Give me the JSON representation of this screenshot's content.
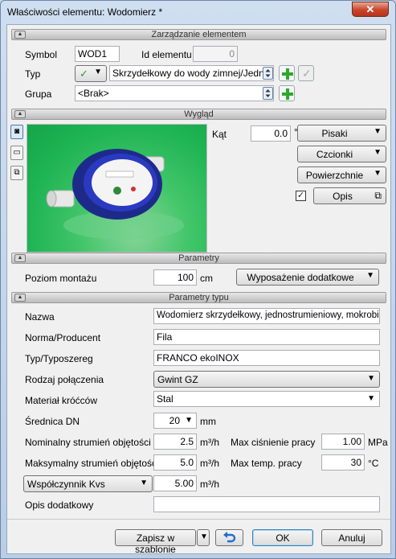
{
  "window": {
    "title": "Właściwości elementu: Wodomierz *",
    "close_glyph": "✕"
  },
  "sections": {
    "management": "Zarządzanie elementem",
    "appearance": "Wygląd",
    "params": "Parametry",
    "type_params": "Parametry typu"
  },
  "management": {
    "symbol_label": "Symbol",
    "symbol_value": "WOD1",
    "id_label": "Id elementu",
    "id_value": "0",
    "typ_label": "Typ",
    "typ_value": "Skrzydełkowy do wody zimnej/Jednost",
    "grupa_label": "Grupa",
    "grupa_value": "<Brak>"
  },
  "appearance": {
    "angle_label": "Kąt",
    "angle_value": "0.0",
    "angle_unit": "°",
    "pens_label": "Pisaki",
    "fonts_label": "Czcionki",
    "surfaces_label": "Powierzchnie",
    "description_label": "Opis",
    "description_checked": true
  },
  "parameters": {
    "mount_label": "Poziom montażu",
    "mount_value": "100",
    "mount_unit": "cm",
    "equipment_label": "Wyposażenie dodatkowe"
  },
  "type_params": {
    "name_label": "Nazwa",
    "name_value": "Wodomierz skrzydełkowy, jednostrumieniowy, mokrobieżny",
    "norm_label": "Norma/Producent",
    "norm_value": "Fila",
    "type_label": "Typ/Typoszereg",
    "type_value": "FRANCO ekoINOX",
    "conn_label": "Rodzaj połączenia",
    "conn_value": "Gwint GZ",
    "material_label": "Materiał króćców",
    "material_value": "Stal",
    "dn_label": "Średnica DN",
    "dn_value": "20",
    "dn_unit": "mm",
    "nominal_label": "Nominalny strumień objętości",
    "nominal_value": "2.5",
    "nominal_unit": "m³/h",
    "maxflow_label": "Maksymalny strumień objętości",
    "maxflow_value": "5.0",
    "maxflow_unit": "m³/h",
    "maxpress_label": "Max ciśnienie pracy",
    "maxpress_value": "1.00",
    "maxpress_unit": "MPa",
    "maxtemp_label": "Max temp. pracy",
    "maxtemp_value": "30",
    "maxtemp_unit": "°C",
    "kvs_label": "Współczynnik Kvs",
    "kvs_value": "5.00",
    "kvs_unit": "m³/h",
    "extra_label": "Opis dodatkowy",
    "extra_value": ""
  },
  "footer": {
    "save_template": "Zapisz w szablonie",
    "ok": "OK",
    "cancel": "Anuluj"
  }
}
